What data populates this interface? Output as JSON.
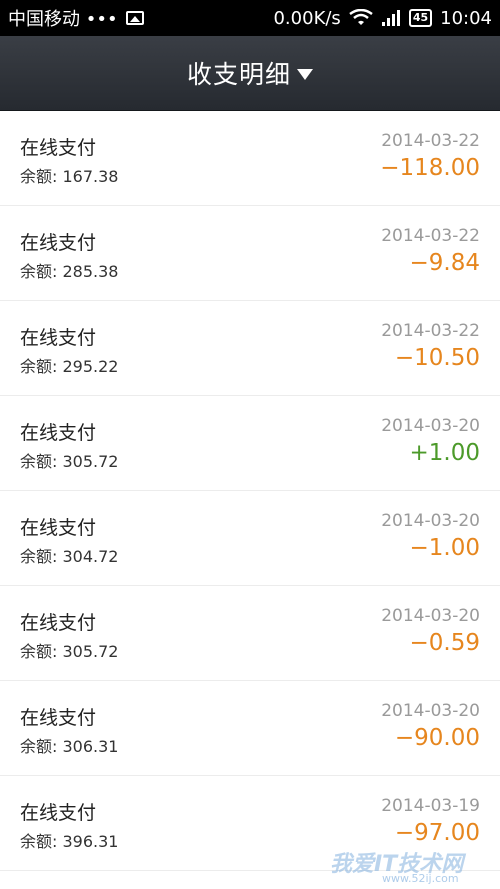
{
  "status_bar": {
    "carrier": "中国移动 •••",
    "network_speed": "0.00K/s",
    "battery": "45",
    "time": "10:04",
    "icons": [
      "image-icon",
      "wifi-icon",
      "signal-icon",
      "battery-icon"
    ]
  },
  "header": {
    "title": "收支明细"
  },
  "transactions": [
    {
      "title": "在线支付",
      "balance": "余额: 167.38",
      "date": "2014-03-22",
      "amount": "−118.00",
      "type": "expense"
    },
    {
      "title": "在线支付",
      "balance": "余额: 285.38",
      "date": "2014-03-22",
      "amount": "−9.84",
      "type": "expense"
    },
    {
      "title": "在线支付",
      "balance": "余额: 295.22",
      "date": "2014-03-22",
      "amount": "−10.50",
      "type": "expense"
    },
    {
      "title": "在线支付",
      "balance": "余额: 305.72",
      "date": "2014-03-20",
      "amount": "+1.00",
      "type": "income"
    },
    {
      "title": "在线支付",
      "balance": "余额: 304.72",
      "date": "2014-03-20",
      "amount": "−1.00",
      "type": "expense"
    },
    {
      "title": "在线支付",
      "balance": "余额: 305.72",
      "date": "2014-03-20",
      "amount": "−0.59",
      "type": "expense"
    },
    {
      "title": "在线支付",
      "balance": "余额: 306.31",
      "date": "2014-03-20",
      "amount": "−90.00",
      "type": "expense"
    },
    {
      "title": "在线支付",
      "balance": "余额: 396.31",
      "date": "2014-03-19",
      "amount": "−97.00",
      "type": "expense"
    }
  ],
  "watermark": {
    "text": "我爱IT技术网",
    "url": "www.52ij.com"
  },
  "colors": {
    "expense": "#e6861e",
    "income": "#4c9a2a",
    "header_bg": "#2f333a"
  }
}
